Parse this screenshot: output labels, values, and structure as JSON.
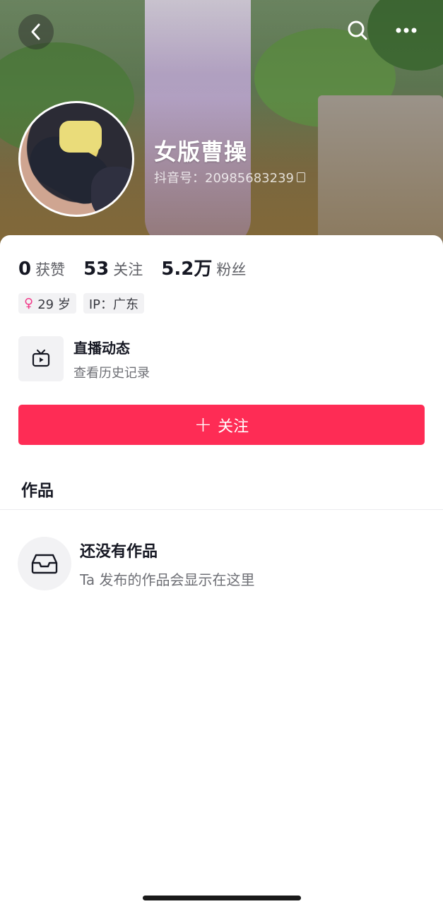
{
  "profile": {
    "name": "女版曹操",
    "douyin_id": "抖音号：20985683239"
  },
  "stats": [
    {
      "value": "0",
      "label": "获赞"
    },
    {
      "value": "53",
      "label": "关注"
    },
    {
      "value": "5.2万",
      "label": "粉丝"
    }
  ],
  "tags": {
    "age": "29 岁",
    "ip": "IP：广东"
  },
  "live": {
    "title": "直播动态",
    "subtitle": "查看历史记录"
  },
  "follow_button": {
    "label": "关注",
    "color": "#fe2c55"
  },
  "tabs": {
    "works": "作品"
  },
  "empty_state": {
    "title": "还没有作品",
    "subtitle": "Ta 发布的作品会显示在这里"
  },
  "icons": {
    "back": "chevron-left-icon",
    "search": "search-icon",
    "more": "more-icon",
    "female": "female-icon",
    "live": "tv-icon",
    "empty": "inbox-icon"
  }
}
